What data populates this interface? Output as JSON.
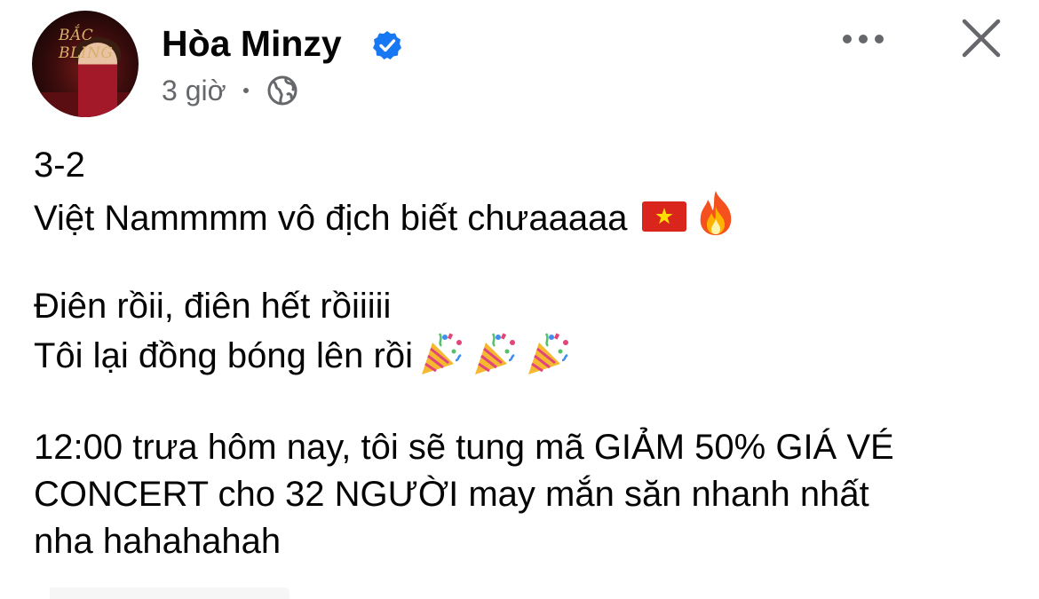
{
  "post": {
    "author_name": "Hòa Minzy",
    "avatar_text": "BẮC BLING",
    "timestamp": "3 giờ",
    "lines": [
      "3-2",
      "Việt Nammmm vô địch biết chưaaaaa",
      "",
      "Điên rồii, điên hết rồiiiii",
      "Tôi lại đồng bóng lên rồi",
      "",
      "12:00 trưa hôm nay, tôi sẽ tung mã GIẢM 50% GIÁ VÉ",
      "CONCERT cho 32 NGƯỜI may mắn săn nhanh nhất",
      "nha hahahahah"
    ]
  },
  "icons": {
    "verified": "verified-badge-icon",
    "privacy": "globe-icon",
    "more": "more-options-icon",
    "close": "close-icon",
    "flag": "vietnam-flag-emoji",
    "fire": "fire-emoji",
    "party": "party-popper-emoji"
  },
  "colors": {
    "text": "#050505",
    "secondary_text": "#65676b",
    "verified_blue": "#1877f2",
    "flag_red": "#da251d",
    "flag_star": "#ffde00"
  }
}
